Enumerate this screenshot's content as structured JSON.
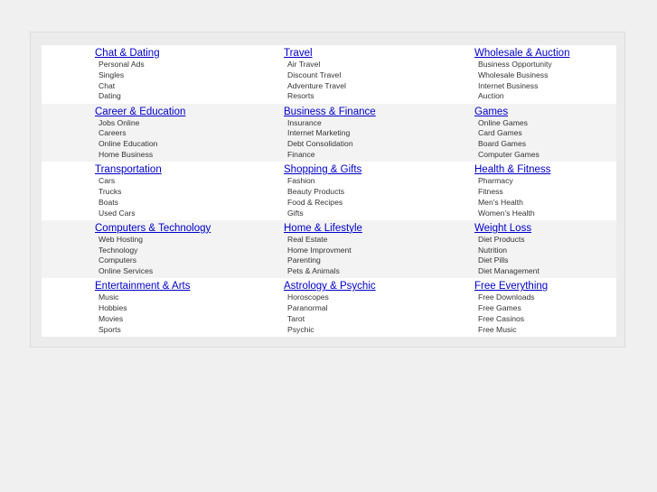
{
  "rows": [
    [
      {
        "title": "Chat & Dating",
        "items": [
          "Personal Ads",
          "Singles",
          "Chat",
          "Dating"
        ]
      },
      {
        "title": "Travel",
        "items": [
          "Air Travel",
          "Discount Travel",
          "Adventure Travel",
          "Resorts"
        ]
      },
      {
        "title": "Wholesale & Auction",
        "items": [
          "Business Opportunity",
          "Wholesale Business",
          "Internet Business",
          "Auction"
        ]
      }
    ],
    [
      {
        "title": "Career & Education",
        "items": [
          "Jobs Online",
          "Careers",
          "Online Education",
          "Home Business"
        ]
      },
      {
        "title": "Business & Finance",
        "items": [
          "Insurance",
          "Internet Marketing",
          "Debt Consolidation",
          "Finance"
        ]
      },
      {
        "title": "Games",
        "items": [
          "Online Games",
          "Card Games",
          "Board Games",
          "Computer Games"
        ]
      }
    ],
    [
      {
        "title": "Transportation",
        "items": [
          "Cars",
          "Trucks",
          "Boats",
          "Used Cars"
        ]
      },
      {
        "title": "Shopping & Gifts",
        "items": [
          "Fashion",
          "Beauty Products",
          "Food & Recipes",
          "Gifts"
        ]
      },
      {
        "title": "Health & Fitness",
        "items": [
          "Pharmacy",
          "Fitness",
          "Men's Health",
          "Women's Health"
        ]
      }
    ],
    [
      {
        "title": "Computers & Technology",
        "items": [
          "Web Hosting",
          "Technology",
          "Computers",
          "Online Services"
        ]
      },
      {
        "title": "Home & Lifestyle",
        "items": [
          "Real Estate",
          "Home Improvment",
          "Parenting",
          "Pets & Animals"
        ]
      },
      {
        "title": "Weight Loss",
        "items": [
          "Diet Products",
          "Nutrition",
          "Diet Pills",
          "Diet Management"
        ]
      }
    ],
    [
      {
        "title": "Entertainment & Arts",
        "items": [
          "Music",
          "Hobbies",
          "Movies",
          "Sports"
        ]
      },
      {
        "title": "Astrology & Psychic",
        "items": [
          "Horoscopes",
          "Paranormal",
          "Tarot",
          "Psychic"
        ]
      },
      {
        "title": "Free Everything",
        "items": [
          "Free Downloads",
          "Free Games",
          "Free Casinos",
          "Free Music"
        ]
      }
    ]
  ]
}
